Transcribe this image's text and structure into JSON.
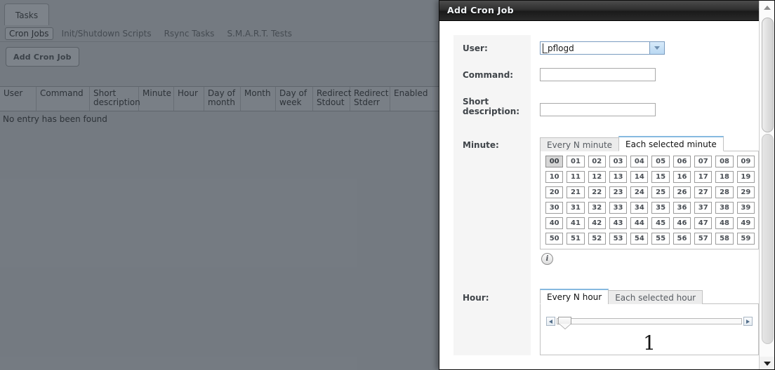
{
  "background": {
    "main_tab": "Tasks",
    "sub_tabs": [
      {
        "label": "Cron Jobs",
        "active": true
      },
      {
        "label": "Init/Shutdown Scripts",
        "active": false
      },
      {
        "label": "Rsync Tasks",
        "active": false
      },
      {
        "label": "S.M.A.R.T. Tests",
        "active": false
      }
    ],
    "add_button": "Add Cron Job",
    "table": {
      "columns": [
        {
          "label": "User",
          "width": 52
        },
        {
          "label": "Command",
          "width": 76
        },
        {
          "label": "Short description",
          "width": 70
        },
        {
          "label": "Minute",
          "width": 50
        },
        {
          "label": "Hour",
          "width": 43
        },
        {
          "label": "Day of month",
          "width": 52
        },
        {
          "label": "Month",
          "width": 50
        },
        {
          "label": "Day of week",
          "width": 53
        },
        {
          "label": "Redirect Stdout",
          "width": 53
        },
        {
          "label": "Redirect Stderr",
          "width": 57
        },
        {
          "label": "Enabled",
          "width": 70
        }
      ],
      "empty_message": "No entry has been found"
    }
  },
  "dialog": {
    "title": "Add Cron Job",
    "close_label": "✖",
    "fields": {
      "user_label": "User:",
      "user_value": "_pflogd",
      "command_label": "Command:",
      "command_value": "",
      "command_placeholder": "",
      "short_description_label": "Short description:",
      "short_description_value": "",
      "short_description_placeholder": "",
      "minute_label": "Minute:",
      "hour_label": "Hour:"
    },
    "minute": {
      "tabs": [
        {
          "label": "Every N minute",
          "active": false
        },
        {
          "label": "Each selected minute",
          "active": true
        }
      ],
      "values": [
        "00",
        "01",
        "02",
        "03",
        "04",
        "05",
        "06",
        "07",
        "08",
        "09",
        "10",
        "11",
        "12",
        "13",
        "14",
        "15",
        "16",
        "17",
        "18",
        "19",
        "20",
        "21",
        "22",
        "23",
        "24",
        "25",
        "26",
        "27",
        "28",
        "29",
        "30",
        "31",
        "32",
        "33",
        "34",
        "35",
        "36",
        "37",
        "38",
        "39",
        "40",
        "41",
        "42",
        "43",
        "44",
        "45",
        "46",
        "47",
        "48",
        "49",
        "50",
        "51",
        "52",
        "53",
        "54",
        "55",
        "56",
        "57",
        "58",
        "59"
      ],
      "selected": [
        "00"
      ],
      "info_icon": "info-icon",
      "info_glyph": "i"
    },
    "hour": {
      "tabs": [
        {
          "label": "Every N hour",
          "active": true
        },
        {
          "label": "Each selected hour",
          "active": false
        }
      ],
      "slider_value": "1",
      "slider_min": 1,
      "slider_max": 24,
      "dec_icon": "arrow-left-icon",
      "inc_icon": "arrow-right-icon"
    }
  },
  "scrollbar": {
    "up_icon": "arrow-up-icon",
    "down_icon": "arrow-down-icon"
  },
  "colors": {
    "accent": "#86b9e0",
    "dialog_title_bg": "#2f2f2f",
    "label_bg": "#f5f5f5",
    "app_bg": "#8d939a",
    "selected_cell": "#d6d6d6"
  }
}
